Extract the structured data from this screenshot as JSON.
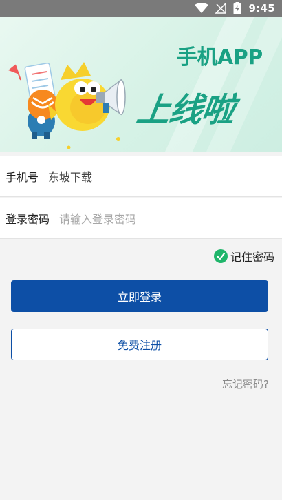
{
  "status_bar": {
    "time": "9:45",
    "icons": [
      "wifi-icon",
      "signal-icon",
      "battery-charging-icon"
    ]
  },
  "banner": {
    "title": "手机APP",
    "slogan": "上线啦",
    "accent_color": "#1aa184"
  },
  "form": {
    "phone": {
      "label": "手机号",
      "value": "东坡下载"
    },
    "password": {
      "label": "登录密码",
      "placeholder": "请输入登录密码"
    },
    "remember": {
      "label": "记住密码",
      "checked": true
    }
  },
  "buttons": {
    "login": "立即登录",
    "register": "免费注册"
  },
  "links": {
    "forgot_password": "忘记密码?"
  },
  "colors": {
    "primary": "#0d4fa6",
    "check": "#1fb56a",
    "status_bar": "#7a7a7a"
  }
}
